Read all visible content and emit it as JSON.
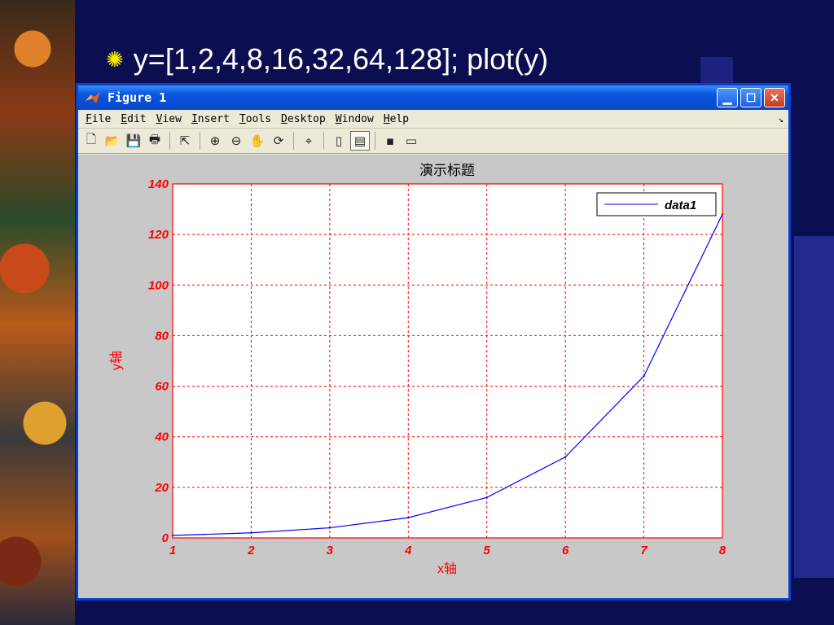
{
  "slide": {
    "bullet_text": "y=[1,2,4,8,16,32,64,128]; plot(y)"
  },
  "window": {
    "title": "Figure 1",
    "menu": [
      "File",
      "Edit",
      "View",
      "Insert",
      "Tools",
      "Desktop",
      "Window",
      "Help"
    ],
    "toolbar_icons": [
      "new-file-icon",
      "open-folder-icon",
      "save-icon",
      "print-icon",
      "pointer-icon",
      "zoom-in-icon",
      "zoom-out-icon",
      "pan-hand-icon",
      "rotate-3d-icon",
      "data-cursor-icon",
      "colorbar-icon",
      "legend-icon",
      "hide-plot-tools-icon",
      "show-plot-tools-icon"
    ]
  },
  "colors": {
    "axis": "#ff0000",
    "line": "#0000ff",
    "title_bar": "#0a58e0"
  },
  "chart_data": {
    "type": "line",
    "title": "演示标题",
    "xlabel": "x轴",
    "ylabel": "y轴",
    "x": [
      1,
      2,
      3,
      4,
      5,
      6,
      7,
      8
    ],
    "series": [
      {
        "name": "data1",
        "values": [
          1,
          2,
          4,
          8,
          16,
          32,
          64,
          128
        ]
      }
    ],
    "xlim": [
      1,
      8
    ],
    "ylim": [
      0,
      140
    ],
    "xticks": [
      1,
      2,
      3,
      4,
      5,
      6,
      7,
      8
    ],
    "yticks": [
      0,
      20,
      40,
      60,
      80,
      100,
      120,
      140
    ],
    "grid": true,
    "legend": "top-right"
  }
}
